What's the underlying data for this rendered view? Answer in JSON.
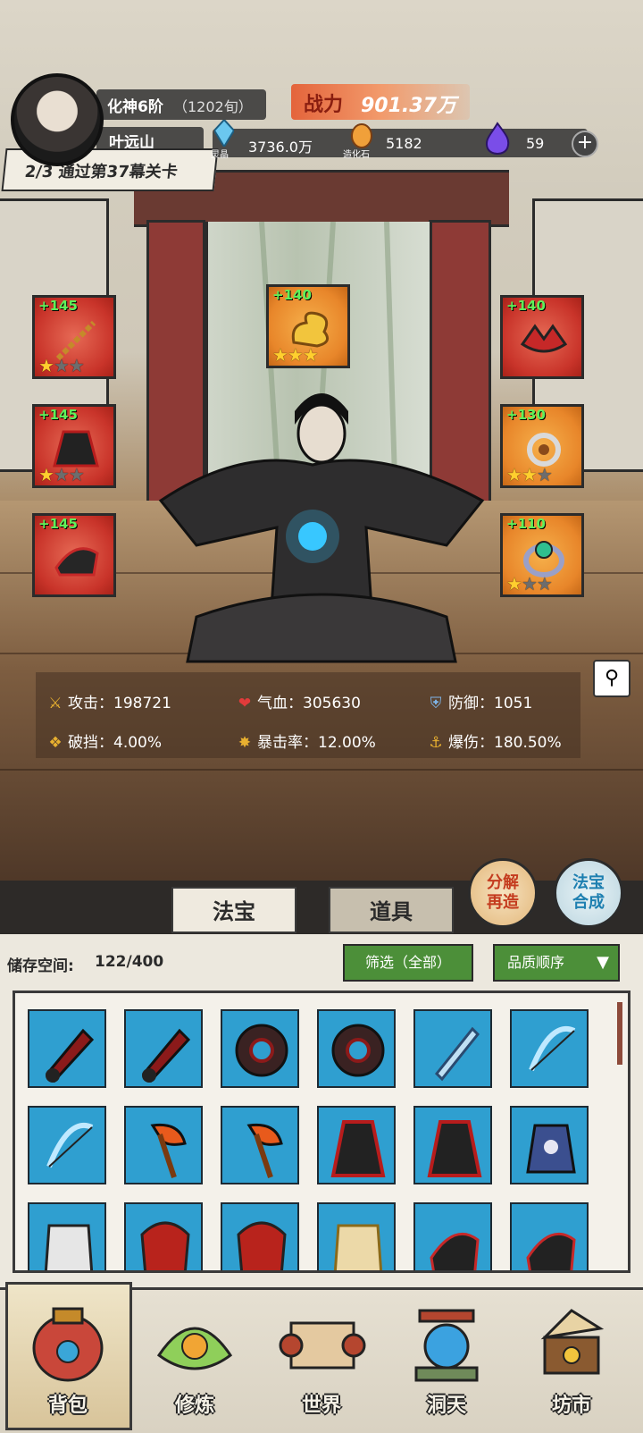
{
  "header": {
    "realm": "化神6阶",
    "age": "（1202旬）",
    "power_label": "战力",
    "power_value": "901.37万",
    "player_name": "叶远山",
    "stage_text": "2/3 通过第37幕关卡",
    "resources": [
      {
        "name": "灵晶",
        "value": "3736.0万",
        "icon": "blue-crystal-icon"
      },
      {
        "name": "造化石",
        "value": "5182",
        "icon": "orange-stone-icon"
      },
      {
        "name": "",
        "value": "59",
        "icon": "purple-flame-icon"
      }
    ],
    "add_label": "+"
  },
  "equipment": {
    "left": [
      {
        "plus": "+145",
        "stars": 1,
        "max": 3,
        "color": "#c9342a",
        "icon": "chain-whip-icon"
      },
      {
        "plus": "+145",
        "stars": 1,
        "max": 3,
        "color": "#c9342a",
        "icon": "dark-robe-icon"
      },
      {
        "plus": "+145",
        "stars": 0,
        "max": 0,
        "color": "#c9342a",
        "icon": "dark-boots-icon"
      }
    ],
    "top": {
      "plus": "+140",
      "stars": 3,
      "max": 3,
      "color": "#e8862a",
      "icon": "golden-cloud-icon"
    },
    "right": [
      {
        "plus": "+140",
        "stars": 0,
        "max": 0,
        "color": "#c9342a",
        "icon": "crown-icon"
      },
      {
        "plus": "+130",
        "stars": 2,
        "max": 3,
        "color": "#e8862a",
        "icon": "jade-pendant-icon"
      },
      {
        "plus": "+110",
        "stars": 1,
        "max": 3,
        "color": "#e8862a",
        "icon": "emerald-ring-icon"
      }
    ]
  },
  "stats": [
    {
      "label": "攻击：",
      "value": "198721",
      "icon": "sword-icon"
    },
    {
      "label": "气血：",
      "value": "305630",
      "icon": "heart-icon"
    },
    {
      "label": "防御：",
      "value": "1051",
      "icon": "shield-icon"
    },
    {
      "label": "破挡：",
      "value": "4.00%",
      "icon": "break-icon"
    },
    {
      "label": "暴击率：",
      "value": "12.00%",
      "icon": "crit-icon"
    },
    {
      "label": "爆伤：",
      "value": "180.50%",
      "icon": "anchor-icon"
    }
  ],
  "tabs": {
    "treasure": "法宝",
    "items": "道具"
  },
  "round_buttons": {
    "decompose_line1": "分解",
    "decompose_line2": "再造",
    "synthesize_line1": "法宝",
    "synthesize_line2": "合成"
  },
  "bag": {
    "storage_label": "储存空间:",
    "storage_value": "122/400",
    "filter_label": "筛选（全部）",
    "sort_label": "品质顺序",
    "items": [
      {
        "icon": "red-dagger-icon"
      },
      {
        "icon": "red-dagger-icon"
      },
      {
        "icon": "spiked-ring-icon"
      },
      {
        "icon": "spiked-ring-icon"
      },
      {
        "icon": "blue-sword-icon"
      },
      {
        "icon": "blue-bow-icon"
      },
      {
        "icon": "blue-bow-icon"
      },
      {
        "icon": "fire-axe-icon"
      },
      {
        "icon": "fire-axe-icon"
      },
      {
        "icon": "dark-robe-icon"
      },
      {
        "icon": "dark-robe-icon"
      },
      {
        "icon": "blue-robe-icon"
      },
      {
        "icon": "white-armor-icon"
      },
      {
        "icon": "red-armor-icon"
      },
      {
        "icon": "red-armor-icon"
      },
      {
        "icon": "gold-armor-icon"
      },
      {
        "icon": "dark-boots-icon"
      },
      {
        "icon": "dark-boots-icon"
      }
    ]
  },
  "nav": [
    {
      "label": "背包",
      "icon": "bag-icon",
      "active": true
    },
    {
      "label": "修炼",
      "icon": "lotus-icon",
      "active": false
    },
    {
      "label": "世界",
      "icon": "scroll-icon",
      "active": false
    },
    {
      "label": "洞天",
      "icon": "portal-icon",
      "active": false
    },
    {
      "label": "坊市",
      "icon": "market-icon",
      "active": false
    }
  ]
}
